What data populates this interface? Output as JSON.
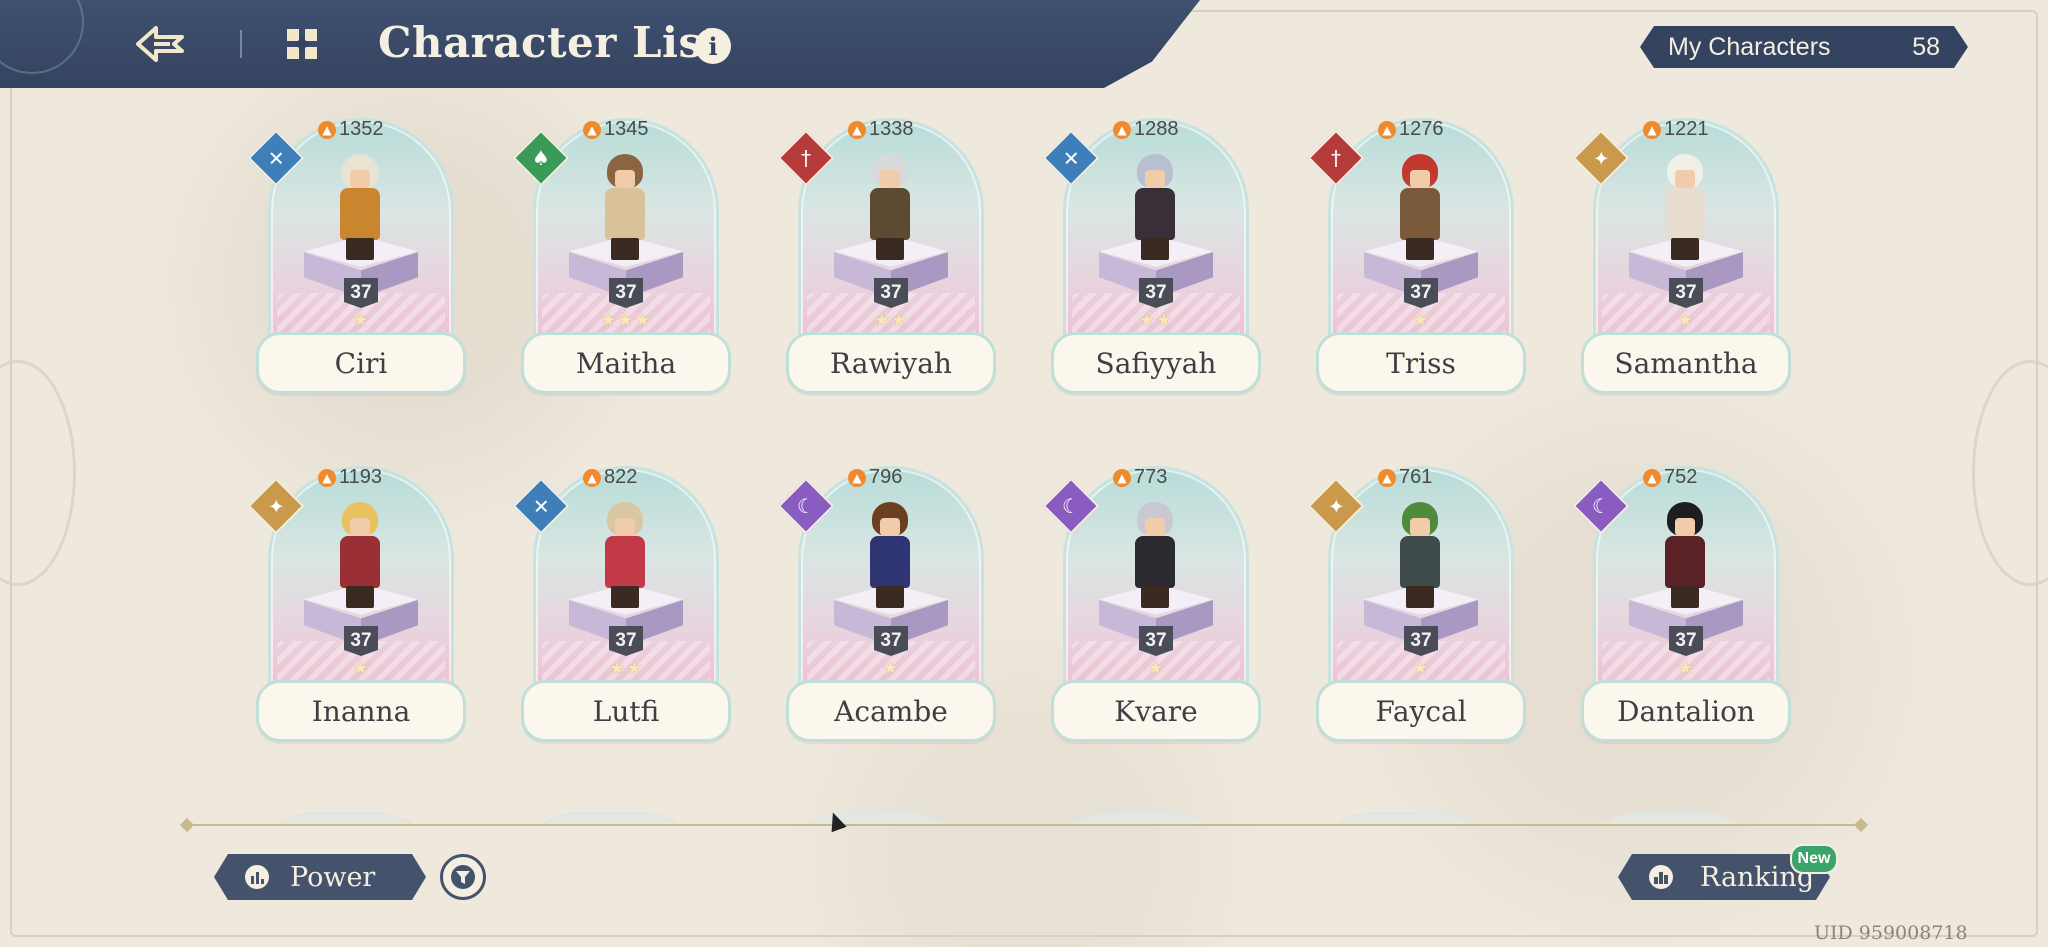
{
  "header": {
    "title": "Character List",
    "info_label": "i",
    "my_characters_label": "My Characters",
    "my_characters_count": "58"
  },
  "element_colors": {
    "wind": "#3e7fb9",
    "earth": "#3a9a58",
    "fire": "#b63b3b",
    "light": "#c99a4c",
    "dark": "#8a5bc1"
  },
  "characters": [
    {
      "name": "Ciri",
      "power": "1352",
      "level": "37",
      "stars": "★",
      "element": "wind",
      "element_icon": "wind-icon",
      "hair": "#e9e3d2",
      "outfit": "#c9862f"
    },
    {
      "name": "Maitha",
      "power": "1345",
      "level": "37",
      "stars": "★★★",
      "element": "earth",
      "element_icon": "leaf-shield-icon",
      "hair": "#8a6540",
      "outfit": "#d9c29a"
    },
    {
      "name": "Rawiyah",
      "power": "1338",
      "level": "37",
      "stars": "★★",
      "element": "fire",
      "element_icon": "sword-icon",
      "hair": "#d9d9d9",
      "outfit": "#5d4a32"
    },
    {
      "name": "Safiyyah",
      "power": "1288",
      "level": "37",
      "stars": "★★",
      "element": "wind",
      "element_icon": "wind-icon",
      "hair": "#b8bfd0",
      "outfit": "#3a2f38"
    },
    {
      "name": "Triss",
      "power": "1276",
      "level": "37",
      "stars": "★",
      "element": "fire",
      "element_icon": "sword-icon",
      "hair": "#c23a2f",
      "outfit": "#7a5a3a"
    },
    {
      "name": "Samantha",
      "power": "1221",
      "level": "37",
      "stars": "★",
      "element": "light",
      "element_icon": "sun-icon",
      "hair": "#f0efe8",
      "outfit": "#e6ddd0"
    },
    {
      "name": "Inanna",
      "power": "1193",
      "level": "37",
      "stars": "★",
      "element": "light",
      "element_icon": "sun-icon",
      "hair": "#e8c260",
      "outfit": "#9a2f35"
    },
    {
      "name": "Lutfi",
      "power": "822",
      "level": "37",
      "stars": "★★",
      "element": "wind",
      "element_icon": "wind-icon",
      "hair": "#d9c7a4",
      "outfit": "#c23a48"
    },
    {
      "name": "Acambe",
      "power": "796",
      "level": "37",
      "stars": "★",
      "element": "dark",
      "element_icon": "moon-icon",
      "hair": "#6a4020",
      "outfit": "#2f3572"
    },
    {
      "name": "Kvare",
      "power": "773",
      "level": "37",
      "stars": "★",
      "element": "dark",
      "element_icon": "moon-icon",
      "hair": "#c9c9d3",
      "outfit": "#2a2a30"
    },
    {
      "name": "Faycal",
      "power": "761",
      "level": "37",
      "stars": "★",
      "element": "light",
      "element_icon": "sun-icon",
      "hair": "#4f8a3c",
      "outfit": "#3f4a4a"
    },
    {
      "name": "Dantalion",
      "power": "752",
      "level": "37",
      "stars": "★",
      "element": "dark",
      "element_icon": "moon-icon",
      "hair": "#1e1e22",
      "outfit": "#5a2226"
    }
  ],
  "footer": {
    "sort_label": "Power",
    "ranking_label": "Ranking",
    "new_badge": "New",
    "uid": "UID 959008718"
  }
}
